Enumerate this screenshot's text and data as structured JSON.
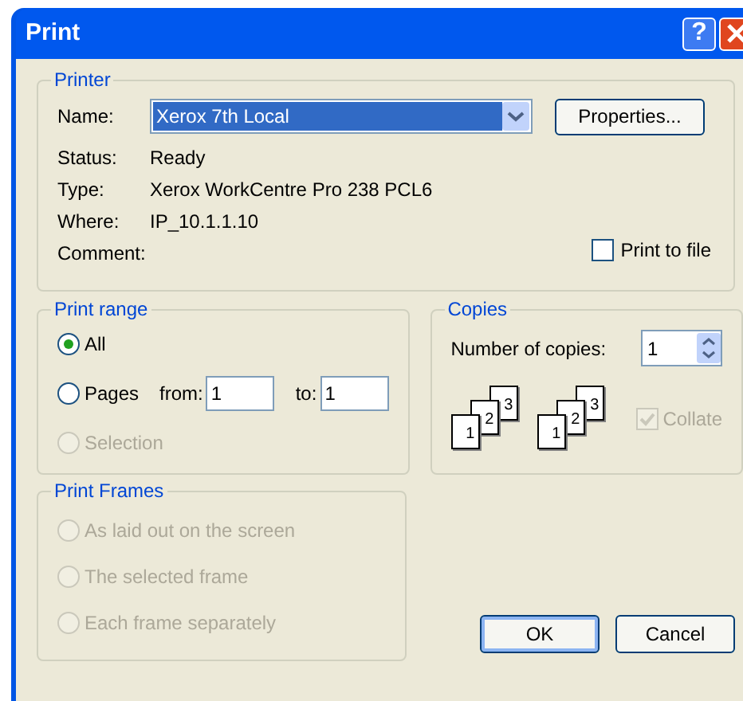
{
  "window": {
    "title": "Print",
    "help": "?"
  },
  "printer": {
    "legend": "Printer",
    "name_label": "Name:",
    "name_value": "Xerox 7th Local",
    "properties": "Properties...",
    "info": [
      {
        "label": "Status:",
        "value": "Ready"
      },
      {
        "label": "Type:",
        "value": "Xerox WorkCentre Pro 238 PCL6"
      },
      {
        "label": "Where:",
        "value": "IP_10.1.1.10"
      },
      {
        "label": "Comment:"
      }
    ],
    "print_to_file": {
      "label": "Print to file",
      "checked": false
    }
  },
  "print_range": {
    "legend": "Print range",
    "options": [
      {
        "kind": "plain",
        "label": "All",
        "selected": true,
        "disabled": false
      },
      {
        "kind": "pages",
        "label": "Pages",
        "selected": false,
        "disabled": false,
        "from_label": "from:",
        "from": "1",
        "to_label": "to:",
        "to": "1"
      },
      {
        "kind": "plain",
        "label": "Selection",
        "selected": false,
        "disabled": true
      }
    ]
  },
  "copies": {
    "legend": "Copies",
    "label": "Number of copies:",
    "value": "1",
    "stacks": [
      [
        "1",
        "2",
        "3"
      ],
      [
        "1",
        "2",
        "3"
      ]
    ],
    "collate": {
      "label": "Collate",
      "checked": true,
      "disabled": true
    }
  },
  "print_frames": {
    "legend": "Print Frames",
    "options": [
      {
        "label": "As laid out on the screen",
        "selected": false,
        "disabled": true
      },
      {
        "label": "The selected frame",
        "selected": false,
        "disabled": true
      },
      {
        "label": "Each frame separately",
        "selected": false,
        "disabled": true
      }
    ]
  },
  "buttons": [
    {
      "label": "OK",
      "default": true
    },
    {
      "label": "Cancel",
      "default": false
    }
  ]
}
